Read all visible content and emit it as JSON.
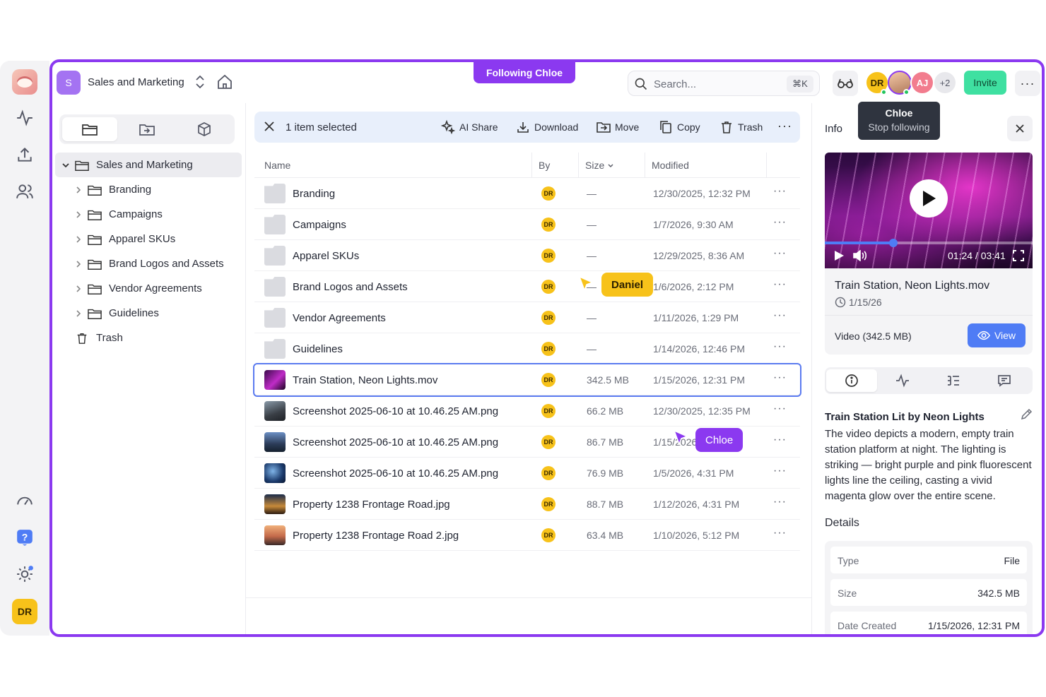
{
  "app": {
    "workspace_badge": "S",
    "workspace_name": "Sales and Marketing",
    "following_banner": "Following Chloe",
    "search_placeholder": "Search...",
    "search_shortcut": "⌘K",
    "invite_label": "Invite",
    "menu_label": "···",
    "rail_avatar": "DR"
  },
  "presence": {
    "avatars": [
      {
        "initials": "DR",
        "color": "#f7c21a"
      },
      {
        "initials": "",
        "name": "Chloe",
        "color": "#8b39f0"
      },
      {
        "initials": "AJ",
        "color": "#f27c8e"
      },
      {
        "initials": "+2",
        "color": "#e8e8ec"
      }
    ],
    "tooltip_name": "Chloe",
    "tooltip_action": "Stop following"
  },
  "sidebar": {
    "root": "Sales and Marketing",
    "folders": [
      "Branding",
      "Campaigns",
      "Apparel SKUs",
      "Brand Logos and Assets",
      "Vendor Agreements",
      "Guidelines"
    ],
    "trash": "Trash"
  },
  "selection_bar": {
    "count_label": "1 item selected",
    "actions": [
      "AI Share",
      "Download",
      "Move",
      "Copy",
      "Trash"
    ],
    "more": "···"
  },
  "table": {
    "columns": [
      "Name",
      "By",
      "Size",
      "Modified"
    ],
    "rows": [
      {
        "name": "Branding",
        "by": "DR",
        "size": "—",
        "modified": "12/30/2025, 12:32 PM",
        "type": "folder"
      },
      {
        "name": "Campaigns",
        "by": "DR",
        "size": "—",
        "modified": "1/7/2026, 9:30 AM",
        "type": "folder"
      },
      {
        "name": "Apparel SKUs",
        "by": "DR",
        "size": "—",
        "modified": "12/29/2025, 8:36 AM",
        "type": "folder"
      },
      {
        "name": "Brand Logos and Assets",
        "by": "DR",
        "size": "—",
        "modified": "1/6/2026, 2:12 PM",
        "type": "folder"
      },
      {
        "name": "Vendor Agreements",
        "by": "DR",
        "size": "—",
        "modified": "1/11/2026, 1:29 PM",
        "type": "folder"
      },
      {
        "name": "Guidelines",
        "by": "DR",
        "size": "—",
        "modified": "1/14/2026, 12:46 PM",
        "type": "folder"
      },
      {
        "name": "Train Station, Neon Lights.mov",
        "by": "DR",
        "size": "342.5 MB",
        "modified": "1/15/2026, 12:31 PM",
        "type": "video",
        "selected": true
      },
      {
        "name": "Screenshot 2025-06-10 at 10.46.25 AM.png",
        "by": "DR",
        "size": "66.2 MB",
        "modified": "12/30/2025, 12:35 PM",
        "type": "image1"
      },
      {
        "name": "Screenshot 2025-06-10 at 10.46.25 AM.png",
        "by": "DR",
        "size": "86.7 MB",
        "modified": "1/15/2026, 3:38 PM",
        "type": "image2"
      },
      {
        "name": "Screenshot 2025-06-10 at 10.46.25 AM.png",
        "by": "DR",
        "size": "76.9 MB",
        "modified": "1/5/2026, 4:31 PM",
        "type": "image3"
      },
      {
        "name": "Property 1238 Frontage Road.jpg",
        "by": "DR",
        "size": "88.7 MB",
        "modified": "1/12/2026, 4:31 PM",
        "type": "image4"
      },
      {
        "name": "Property 1238 Frontage Road 2.jpg",
        "by": "DR",
        "size": "63.4 MB",
        "modified": "1/10/2026, 5:12 PM",
        "type": "image5"
      }
    ],
    "row_more": "···"
  },
  "cursors": {
    "daniel": "Daniel",
    "chloe": "Chloe"
  },
  "info": {
    "title": "Info",
    "player_time": "01:24 / 03:41",
    "playback_progress": 0.33,
    "file_name": "Train Station, Neon Lights.mov",
    "file_date": "1/15/26",
    "file_type_size": "Video (342.5 MB)",
    "view_label": "View",
    "description_title": "Train Station Lit by Neon Lights",
    "description": "The video depicts a modern, empty train station platform at night. The lighting is striking — bright purple and pink fluorescent lights line the ceiling, casting a vivid magenta glow over the entire scene.",
    "details_title": "Details",
    "details": [
      {
        "key": "Type",
        "value": "File"
      },
      {
        "key": "Size",
        "value": "342.5 MB"
      },
      {
        "key": "Date Created",
        "value": "1/15/2026, 12:31 PM"
      }
    ]
  }
}
